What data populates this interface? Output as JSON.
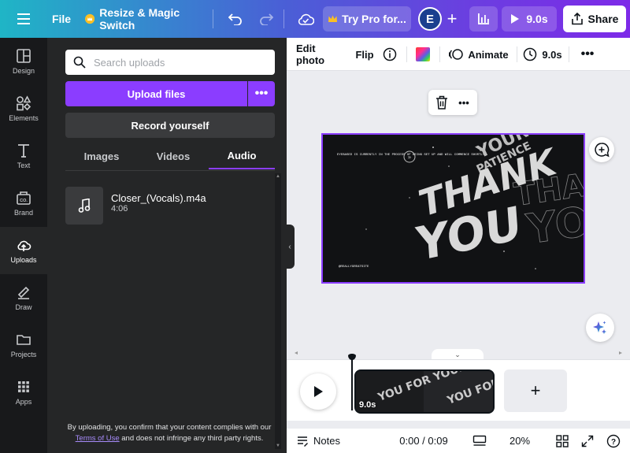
{
  "topbar": {
    "file_label": "File",
    "resize_label": "Resize & Magic Switch",
    "try_pro_label": "Try Pro for...",
    "avatar_initial": "E",
    "duration_label": "9.0s",
    "share_label": "Share"
  },
  "rail": {
    "items": [
      {
        "label": "Design",
        "icon": "design-icon"
      },
      {
        "label": "Elements",
        "icon": "elements-icon"
      },
      {
        "label": "Text",
        "icon": "text-icon"
      },
      {
        "label": "Brand",
        "icon": "brand-icon"
      },
      {
        "label": "Uploads",
        "icon": "upload-cloud-icon"
      },
      {
        "label": "Draw",
        "icon": "draw-icon"
      },
      {
        "label": "Projects",
        "icon": "folder-icon"
      },
      {
        "label": "Apps",
        "icon": "apps-grid-icon"
      }
    ],
    "active": "Uploads"
  },
  "uploads": {
    "search_placeholder": "Search uploads",
    "upload_button": "Upload files",
    "more_button": "•••",
    "record_button": "Record yourself",
    "tabs": [
      "Images",
      "Videos",
      "Audio"
    ],
    "active_tab": "Audio",
    "files": [
      {
        "name": "Closer_(Vocals).m4a",
        "duration": "4:06"
      }
    ],
    "disclaimer_before": "By uploading, you confirm that your content complies with our ",
    "terms_link": "Terms of Use",
    "disclaimer_after": " and does not infringe any third party rights."
  },
  "context_toolbar": {
    "edit_photo": "Edit photo",
    "flip": "Flip",
    "animate": "Animate",
    "duration": "9.0s"
  },
  "design": {
    "big_text_1": "THANK",
    "big_text_2": "YOU",
    "top_text_1": "YOUR",
    "top_text_2": "PATIENCE",
    "small_text": "EYEBASED IS CURRENTLY IN THE PROCESS OF BEING SET UP AND WILL COMMENCE SHORTLY.",
    "handle": "@REALLYGREATSITE"
  },
  "timeline": {
    "clip_duration": "9.0s",
    "clip_text": "YOU FOR YOUR"
  },
  "bottombar": {
    "notes_label": "Notes",
    "time_label": "0:00 / 0:09",
    "zoom_label": "20%",
    "help_label": "?"
  },
  "colors": {
    "accent": "#8b3dff",
    "panel_bg": "#252627",
    "rail_bg": "#18191b",
    "canvas_bg": "#ebecf0"
  }
}
